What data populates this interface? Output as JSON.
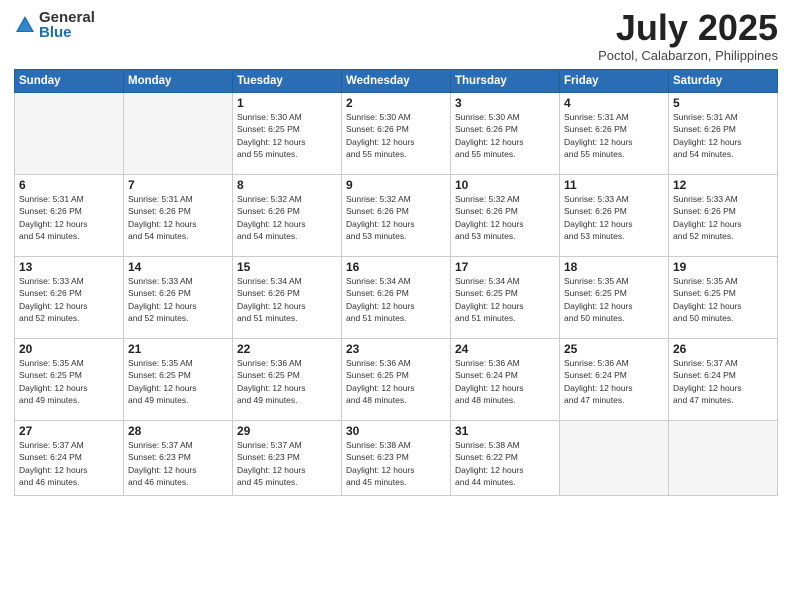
{
  "logo": {
    "general": "General",
    "blue": "Blue"
  },
  "title": {
    "month": "July 2025",
    "location": "Poctol, Calabarzon, Philippines"
  },
  "headers": [
    "Sunday",
    "Monday",
    "Tuesday",
    "Wednesday",
    "Thursday",
    "Friday",
    "Saturday"
  ],
  "weeks": [
    [
      {
        "day": "",
        "info": ""
      },
      {
        "day": "",
        "info": ""
      },
      {
        "day": "1",
        "info": "Sunrise: 5:30 AM\nSunset: 6:25 PM\nDaylight: 12 hours\nand 55 minutes."
      },
      {
        "day": "2",
        "info": "Sunrise: 5:30 AM\nSunset: 6:26 PM\nDaylight: 12 hours\nand 55 minutes."
      },
      {
        "day": "3",
        "info": "Sunrise: 5:30 AM\nSunset: 6:26 PM\nDaylight: 12 hours\nand 55 minutes."
      },
      {
        "day": "4",
        "info": "Sunrise: 5:31 AM\nSunset: 6:26 PM\nDaylight: 12 hours\nand 55 minutes."
      },
      {
        "day": "5",
        "info": "Sunrise: 5:31 AM\nSunset: 6:26 PM\nDaylight: 12 hours\nand 54 minutes."
      }
    ],
    [
      {
        "day": "6",
        "info": "Sunrise: 5:31 AM\nSunset: 6:26 PM\nDaylight: 12 hours\nand 54 minutes."
      },
      {
        "day": "7",
        "info": "Sunrise: 5:31 AM\nSunset: 6:26 PM\nDaylight: 12 hours\nand 54 minutes."
      },
      {
        "day": "8",
        "info": "Sunrise: 5:32 AM\nSunset: 6:26 PM\nDaylight: 12 hours\nand 54 minutes."
      },
      {
        "day": "9",
        "info": "Sunrise: 5:32 AM\nSunset: 6:26 PM\nDaylight: 12 hours\nand 53 minutes."
      },
      {
        "day": "10",
        "info": "Sunrise: 5:32 AM\nSunset: 6:26 PM\nDaylight: 12 hours\nand 53 minutes."
      },
      {
        "day": "11",
        "info": "Sunrise: 5:33 AM\nSunset: 6:26 PM\nDaylight: 12 hours\nand 53 minutes."
      },
      {
        "day": "12",
        "info": "Sunrise: 5:33 AM\nSunset: 6:26 PM\nDaylight: 12 hours\nand 52 minutes."
      }
    ],
    [
      {
        "day": "13",
        "info": "Sunrise: 5:33 AM\nSunset: 6:26 PM\nDaylight: 12 hours\nand 52 minutes."
      },
      {
        "day": "14",
        "info": "Sunrise: 5:33 AM\nSunset: 6:26 PM\nDaylight: 12 hours\nand 52 minutes."
      },
      {
        "day": "15",
        "info": "Sunrise: 5:34 AM\nSunset: 6:26 PM\nDaylight: 12 hours\nand 51 minutes."
      },
      {
        "day": "16",
        "info": "Sunrise: 5:34 AM\nSunset: 6:26 PM\nDaylight: 12 hours\nand 51 minutes."
      },
      {
        "day": "17",
        "info": "Sunrise: 5:34 AM\nSunset: 6:25 PM\nDaylight: 12 hours\nand 51 minutes."
      },
      {
        "day": "18",
        "info": "Sunrise: 5:35 AM\nSunset: 6:25 PM\nDaylight: 12 hours\nand 50 minutes."
      },
      {
        "day": "19",
        "info": "Sunrise: 5:35 AM\nSunset: 6:25 PM\nDaylight: 12 hours\nand 50 minutes."
      }
    ],
    [
      {
        "day": "20",
        "info": "Sunrise: 5:35 AM\nSunset: 6:25 PM\nDaylight: 12 hours\nand 49 minutes."
      },
      {
        "day": "21",
        "info": "Sunrise: 5:35 AM\nSunset: 6:25 PM\nDaylight: 12 hours\nand 49 minutes."
      },
      {
        "day": "22",
        "info": "Sunrise: 5:36 AM\nSunset: 6:25 PM\nDaylight: 12 hours\nand 49 minutes."
      },
      {
        "day": "23",
        "info": "Sunrise: 5:36 AM\nSunset: 6:25 PM\nDaylight: 12 hours\nand 48 minutes."
      },
      {
        "day": "24",
        "info": "Sunrise: 5:36 AM\nSunset: 6:24 PM\nDaylight: 12 hours\nand 48 minutes."
      },
      {
        "day": "25",
        "info": "Sunrise: 5:36 AM\nSunset: 6:24 PM\nDaylight: 12 hours\nand 47 minutes."
      },
      {
        "day": "26",
        "info": "Sunrise: 5:37 AM\nSunset: 6:24 PM\nDaylight: 12 hours\nand 47 minutes."
      }
    ],
    [
      {
        "day": "27",
        "info": "Sunrise: 5:37 AM\nSunset: 6:24 PM\nDaylight: 12 hours\nand 46 minutes."
      },
      {
        "day": "28",
        "info": "Sunrise: 5:37 AM\nSunset: 6:23 PM\nDaylight: 12 hours\nand 46 minutes."
      },
      {
        "day": "29",
        "info": "Sunrise: 5:37 AM\nSunset: 6:23 PM\nDaylight: 12 hours\nand 45 minutes."
      },
      {
        "day": "30",
        "info": "Sunrise: 5:38 AM\nSunset: 6:23 PM\nDaylight: 12 hours\nand 45 minutes."
      },
      {
        "day": "31",
        "info": "Sunrise: 5:38 AM\nSunset: 6:22 PM\nDaylight: 12 hours\nand 44 minutes."
      },
      {
        "day": "",
        "info": ""
      },
      {
        "day": "",
        "info": ""
      }
    ]
  ]
}
